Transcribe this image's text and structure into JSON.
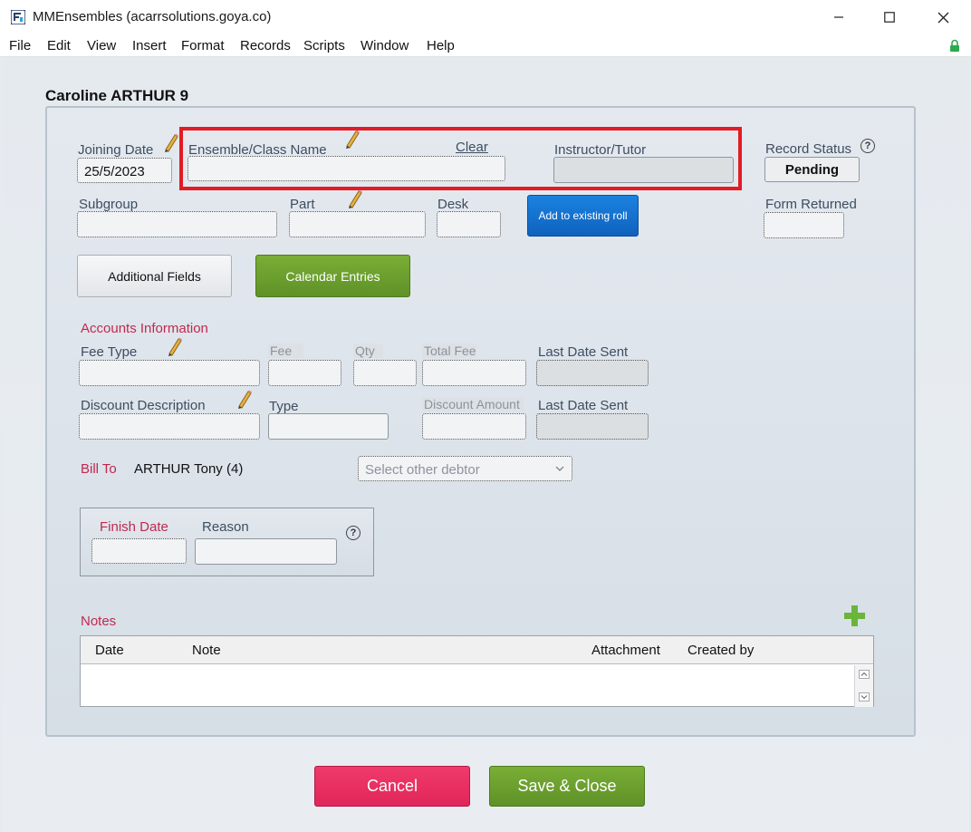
{
  "window": {
    "title": "MMEnsembles (acarrsolutions.goya.co)",
    "minimize_glyph": "—",
    "maximize_glyph": "☐",
    "close_glyph": "✕"
  },
  "menu": [
    "File",
    "Edit",
    "View",
    "Insert",
    "Format",
    "Records",
    "Scripts",
    "Window",
    "Help"
  ],
  "record": {
    "heading": "Caroline ARTHUR 9",
    "joining_date_label": "Joining Date",
    "joining_date_value": "25/5/2023",
    "ensemble_label": "Ensemble/Class Name",
    "clear_label": "Clear",
    "ensemble_value": "",
    "instructor_label": "Instructor/Tutor",
    "instructor_value": "",
    "record_status_label": "Record Status",
    "record_status_value": "Pending",
    "subgroup_label": "Subgroup",
    "part_label": "Part",
    "desk_label": "Desk",
    "add_roll_label": "Add to existing roll",
    "form_returned_label": "Form Returned",
    "additional_fields_label": "Additional Fields",
    "calendar_entries_label": "Calendar Entries"
  },
  "accounts": {
    "section_label": "Accounts Information",
    "fee_type_label": "Fee Type",
    "fee_label": "Fee",
    "qty_label": "Qty",
    "total_fee_label": "Total Fee",
    "last_date_sent_label": "Last Date Sent",
    "discount_description_label": "Discount Description",
    "type_label": "Type",
    "discount_amount_label": "Discount Amount",
    "last_date_sent_label_2": "Last Date Sent",
    "bill_to_label": "Bill To",
    "bill_to_value": "ARTHUR Tony (4)",
    "debtor_placeholder": "Select other debtor"
  },
  "finish": {
    "finish_date_label": "Finish Date",
    "reason_label": "Reason"
  },
  "notes": {
    "section_label": "Notes",
    "columns": [
      "Date",
      "Note",
      "Attachment",
      "Created by"
    ]
  },
  "footer": {
    "cancel_label": "Cancel",
    "save_label": "Save & Close"
  },
  "colors": {
    "highlight": "#e21c24",
    "accent_red": "#c0294f",
    "green": "#6ea22e",
    "blue": "#1270d0",
    "cancel": "#ea2d62"
  }
}
